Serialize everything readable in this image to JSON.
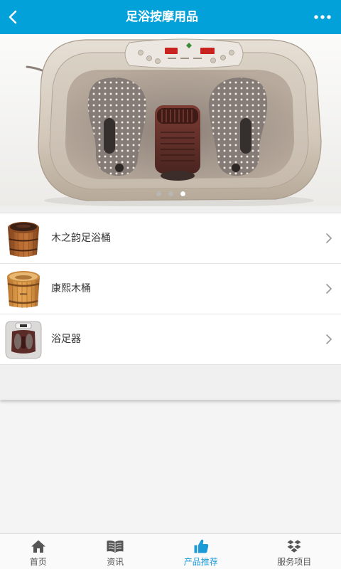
{
  "header": {
    "title": "足浴按摩用品",
    "back_icon": "chevron-left-icon",
    "more_icon": "more-dots-icon"
  },
  "carousel": {
    "slide_count": 3,
    "active_index": 2
  },
  "products": [
    {
      "name": "木之韵足浴桶",
      "chevron_icon": "chevron-right-icon"
    },
    {
      "name": "康熙木桶",
      "chevron_icon": "chevron-right-icon"
    },
    {
      "name": "浴足器",
      "chevron_icon": "chevron-right-icon"
    }
  ],
  "tabbar": {
    "active_index": 2,
    "items": [
      {
        "label": "首页",
        "icon": "home-icon"
      },
      {
        "label": "资讯",
        "icon": "book-icon"
      },
      {
        "label": "产品推荐",
        "icon": "thumbs-up-icon"
      },
      {
        "label": "服务项目",
        "icon": "dropbox-icon"
      }
    ]
  },
  "colors": {
    "primary": "#03a1da",
    "tab_active": "#1a9ad6",
    "tab_inactive": "#555555",
    "page_bg": "#f4f4f4"
  }
}
